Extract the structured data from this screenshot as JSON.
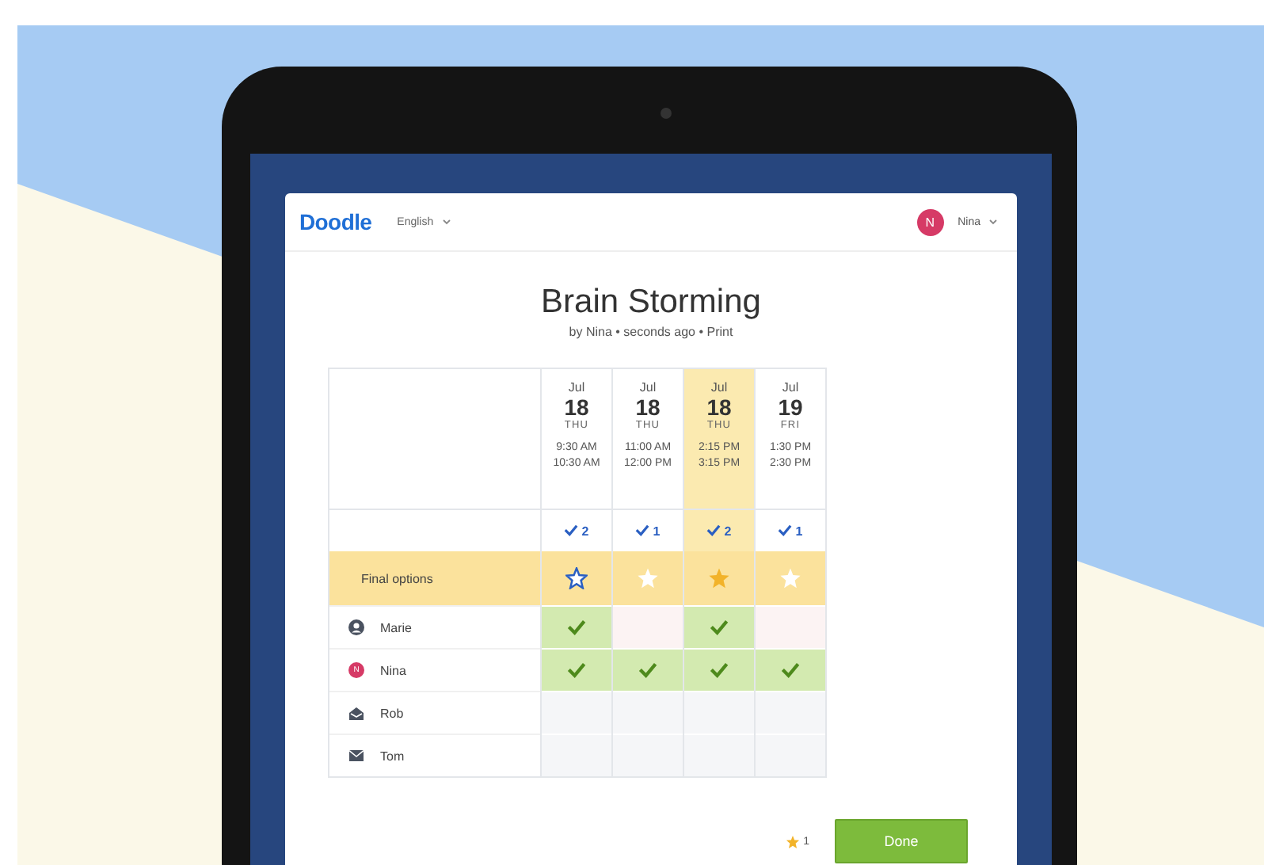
{
  "header": {
    "logo": "Doodle",
    "language": "English",
    "user_initial": "N",
    "user_name": "Nina"
  },
  "poll": {
    "title": "Brain Storming",
    "byline": "by Nina • seconds ago •",
    "print_link": "Print"
  },
  "options": [
    {
      "month": "Jul",
      "day": "18",
      "weekday": "THU",
      "start": "9:30 AM",
      "end": "10:30 AM",
      "votes": "2",
      "selected": false,
      "final": false,
      "hovered": true
    },
    {
      "month": "Jul",
      "day": "18",
      "weekday": "THU",
      "start": "11:00 AM",
      "end": "12:00 PM",
      "votes": "1",
      "selected": false,
      "final": false,
      "hovered": false
    },
    {
      "month": "Jul",
      "day": "18",
      "weekday": "THU",
      "start": "2:15 PM",
      "end": "3:15 PM",
      "votes": "2",
      "selected": true,
      "final": true,
      "hovered": false
    },
    {
      "month": "Jul",
      "day": "19",
      "weekday": "FRI",
      "start": "1:30 PM",
      "end": "2:30 PM",
      "votes": "1",
      "selected": false,
      "final": false,
      "hovered": false
    }
  ],
  "final_options_label": "Final options",
  "participants": [
    {
      "name": "Marie",
      "kind": "person",
      "answers": [
        {
          "kind": "yes"
        },
        {
          "kind": "no"
        },
        {
          "kind": "yes"
        },
        {
          "kind": "no"
        }
      ]
    },
    {
      "name": "Nina",
      "kind": "initial",
      "initial": "N",
      "answers": [
        {
          "kind": "yes"
        },
        {
          "kind": "yes"
        },
        {
          "kind": "yes"
        },
        {
          "kind": "yes"
        }
      ]
    },
    {
      "name": "Rob",
      "kind": "opened",
      "answers": [
        {
          "kind": "pending"
        },
        {
          "kind": "pending"
        },
        {
          "kind": "pending"
        },
        {
          "kind": "pending"
        }
      ]
    },
    {
      "name": "Tom",
      "kind": "invited",
      "answers": [
        {
          "kind": "pending"
        },
        {
          "kind": "pending"
        },
        {
          "kind": "pending"
        },
        {
          "kind": "pending"
        }
      ]
    }
  ],
  "footer": {
    "star_count": "1",
    "done_button": "Done"
  }
}
